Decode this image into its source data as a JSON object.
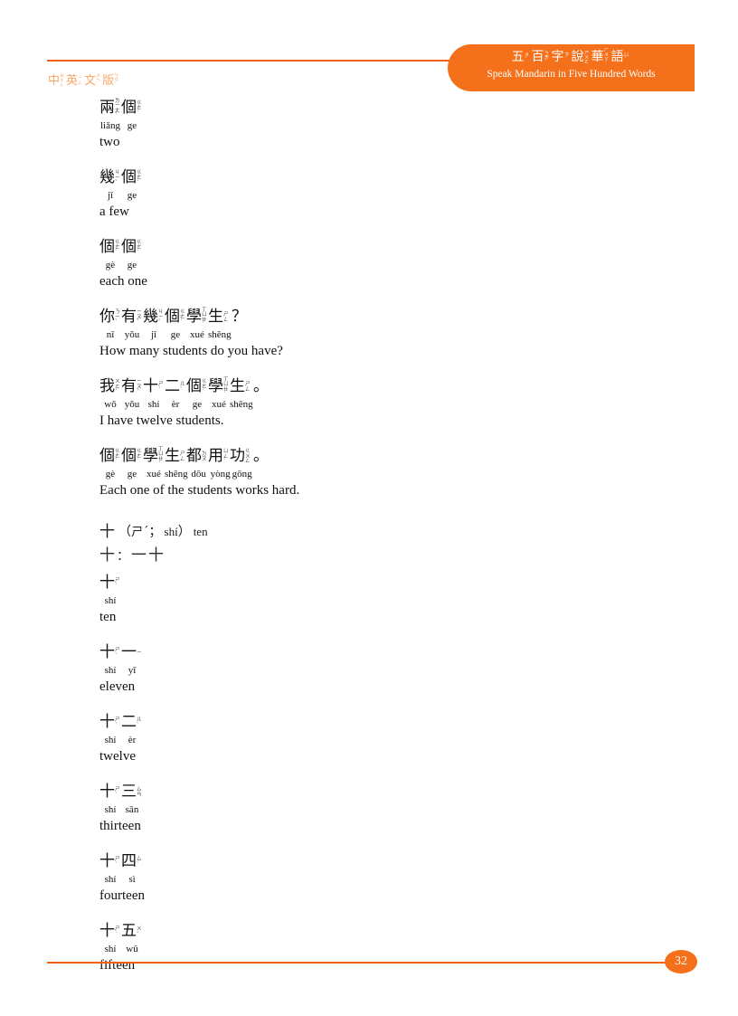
{
  "header": {
    "badge": {
      "chinese_title": "五百字說華語",
      "chinese_chars": [
        {
          "han": "五",
          "bpm": "ㄨˇ"
        },
        {
          "han": "百",
          "bpm": "ㄅㄞˇ"
        },
        {
          "han": "字",
          "bpm": "ㄗˋ"
        },
        {
          "han": "說",
          "bpm": "ㄕㄨㄛ"
        },
        {
          "han": "華",
          "bpm": "ㄏㄨㄚˊ"
        },
        {
          "han": "語",
          "bpm": "ㄩˇ"
        }
      ],
      "english_subtitle": "Speak Mandarin in Five Hundred Words"
    },
    "edition_label": "中英文版",
    "edition_chars": [
      {
        "han": "中",
        "bpm": "ㄓㄨㄥ"
      },
      {
        "han": "英",
        "bpm": "ㄧㄥ"
      },
      {
        "han": "文",
        "bpm": "ㄨㄣˊ"
      },
      {
        "han": "版",
        "bpm": "ㄅㄢˇ"
      }
    ]
  },
  "entries": [
    {
      "chars": [
        {
          "han": "兩",
          "bpm": "ㄌㄧㄤˇ"
        },
        {
          "han": "個",
          "bpm": "ㄍㄜ˙"
        }
      ],
      "pinyin": [
        "liǎng",
        "ge"
      ],
      "english": "two"
    },
    {
      "chars": [
        {
          "han": "幾",
          "bpm": "ㄐㄧˇ"
        },
        {
          "han": "個",
          "bpm": "ㄍㄜ˙"
        }
      ],
      "pinyin": [
        "jǐ",
        "ge"
      ],
      "english": "a few"
    },
    {
      "chars": [
        {
          "han": "個",
          "bpm": "ㄍㄜˋ"
        },
        {
          "han": "個",
          "bpm": "ㄍㄜ˙"
        }
      ],
      "pinyin": [
        "gè",
        "ge"
      ],
      "english": "each one"
    },
    {
      "chars": [
        {
          "han": "你",
          "bpm": "ㄋㄧˇ"
        },
        {
          "han": "有",
          "bpm": "ㄧㄡˇ"
        },
        {
          "han": "幾",
          "bpm": "ㄐㄧˇ"
        },
        {
          "han": "個",
          "bpm": "ㄍㄜ˙"
        },
        {
          "han": "學",
          "bpm": "ㄒㄩㄝˊ"
        },
        {
          "han": "生",
          "bpm": "ㄕㄥ"
        }
      ],
      "trailing_punct": "？",
      "pinyin": [
        "nǐ",
        "yǒu",
        "jǐ",
        "ge",
        "xué",
        "shēng"
      ],
      "english": "How many students do you have?"
    },
    {
      "chars": [
        {
          "han": "我",
          "bpm": "ㄨㄛˇ"
        },
        {
          "han": "有",
          "bpm": "ㄧㄡˇ"
        },
        {
          "han": "十",
          "bpm": "ㄕˊ"
        },
        {
          "han": "二",
          "bpm": "ㄦˋ"
        },
        {
          "han": "個",
          "bpm": "ㄍㄜ˙"
        },
        {
          "han": "學",
          "bpm": "ㄒㄩㄝˊ"
        },
        {
          "han": "生",
          "bpm": "ㄕㄥ"
        }
      ],
      "trailing_punct": "。",
      "pinyin": [
        "wǒ",
        "yǒu",
        "shí",
        "èr",
        "ge",
        "xué",
        "shēng"
      ],
      "english": "I have twelve students."
    },
    {
      "chars": [
        {
          "han": "個",
          "bpm": "ㄍㄜˋ"
        },
        {
          "han": "個",
          "bpm": "ㄍㄜ˙"
        },
        {
          "han": "學",
          "bpm": "ㄒㄩㄝˊ"
        },
        {
          "han": "生",
          "bpm": "ㄕㄥ"
        },
        {
          "han": "都",
          "bpm": "ㄉㄡ"
        },
        {
          "han": "用",
          "bpm": "ㄩㄥˋ"
        },
        {
          "han": "功",
          "bpm": "ㄍㄨㄥ"
        }
      ],
      "trailing_punct": "。",
      "pinyin": [
        "gè",
        "ge",
        "xué",
        "shēng",
        "dōu",
        "yòng",
        "gōng"
      ],
      "english": "Each one of the students works hard."
    }
  ],
  "headword": {
    "character": "十",
    "open_paren": "（",
    "bopomofo": "ㄕ",
    "tone_mark": "ˊ",
    "semicolon": "；",
    "pinyin": "shí",
    "close_paren": "）",
    "gloss": "ten",
    "stroke_label": "十",
    "stroke_colon": "：",
    "stroke_steps": [
      "一",
      "十"
    ]
  },
  "entries2": [
    {
      "chars": [
        {
          "han": "十",
          "bpm": "ㄕˊ"
        }
      ],
      "pinyin": [
        "shí"
      ],
      "english": "ten"
    },
    {
      "chars": [
        {
          "han": "十",
          "bpm": "ㄕˊ"
        },
        {
          "han": "一",
          "bpm": "ㄧ"
        }
      ],
      "pinyin": [
        "shí",
        "yī"
      ],
      "english": "eleven"
    },
    {
      "chars": [
        {
          "han": "十",
          "bpm": "ㄕˊ"
        },
        {
          "han": "二",
          "bpm": "ㄦˋ"
        }
      ],
      "pinyin": [
        "shí",
        "èr"
      ],
      "english": "twelve"
    },
    {
      "chars": [
        {
          "han": "十",
          "bpm": "ㄕˊ"
        },
        {
          "han": "三",
          "bpm": "ㄙㄢ"
        }
      ],
      "pinyin": [
        "shí",
        "sān"
      ],
      "english": "thirteen"
    },
    {
      "chars": [
        {
          "han": "十",
          "bpm": "ㄕˊ"
        },
        {
          "han": "四",
          "bpm": "ㄙˋ"
        }
      ],
      "pinyin": [
        "shí",
        "sì"
      ],
      "english": "fourteen"
    },
    {
      "chars": [
        {
          "han": "十",
          "bpm": "ㄕˊ"
        },
        {
          "han": "五",
          "bpm": "ㄨˇ"
        }
      ],
      "pinyin": [
        "shí",
        "wǔ"
      ],
      "english": "fifteen"
    }
  ],
  "footer": {
    "page_number": "32"
  },
  "colors": {
    "accent_orange": "#f4701b",
    "rule_orange": "#ef6010",
    "edition_orange": "#f9a668"
  }
}
